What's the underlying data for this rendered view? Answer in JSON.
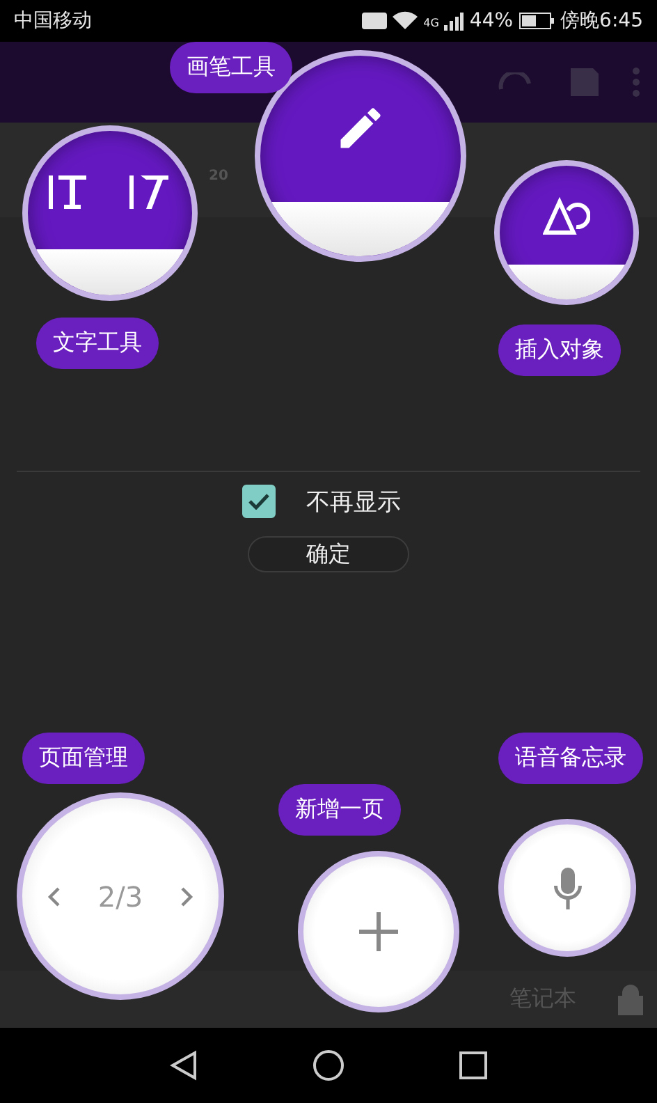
{
  "status_bar": {
    "carrier": "中国移动",
    "network": "4G",
    "battery": "44%",
    "time": "傍晚6:45"
  },
  "ribbon": {
    "font_size": "20"
  },
  "bottom_bar": {
    "notebook": "笔记本"
  },
  "coach_marks": [
    {
      "kind": "pen",
      "label": "画笔工具"
    },
    {
      "kind": "text-tools",
      "label": "文字工具"
    },
    {
      "kind": "shapes",
      "label": "插入对象"
    },
    {
      "kind": "pages",
      "label": "页面管理",
      "page": "2/3"
    },
    {
      "kind": "mic",
      "label": "语音备忘录"
    },
    {
      "kind": "add",
      "label": "新增一页"
    }
  ],
  "dialog": {
    "checkbox": {
      "label": "不再显示",
      "checked": true
    },
    "confirm_button": "确定"
  }
}
